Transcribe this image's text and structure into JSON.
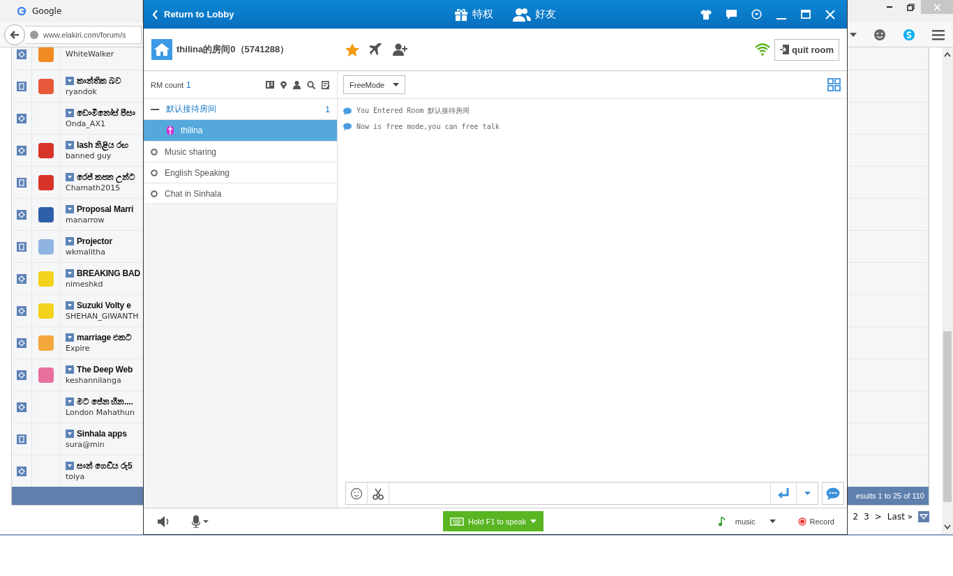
{
  "browser": {
    "tab_title": "Google",
    "url": "www.elakiri.com/forum/s"
  },
  "forum": {
    "threads": [
      {
        "kind": "diamond",
        "author": "WhiteWalker",
        "color": "#f08a24"
      },
      {
        "kind": "page",
        "title": "කාන්තික බව",
        "author": "ryandok",
        "color": "#e8583a"
      },
      {
        "kind": "diamond",
        "title": "ඩොමිනෝස් පීසා",
        "author": "Onda_AX1"
      },
      {
        "kind": "diamond",
        "title": "lash නිළිය රඟ",
        "author": "banned guy",
        "color": "#d9342b"
      },
      {
        "kind": "page",
        "title": "රෙජ් කපන උන්ට",
        "author": "Chamath2015",
        "color": "#d9342b"
      },
      {
        "kind": "diamond",
        "title": "Proposal Marri",
        "author": "manarrow",
        "color": "#2d5fa8"
      },
      {
        "kind": "page",
        "title": "Projector",
        "author": "wkmalitha",
        "color": "#8fb4e0"
      },
      {
        "kind": "diamond",
        "title": "BREAKING BAD",
        "author": "nimeshkd",
        "color": "#f3d21b"
      },
      {
        "kind": "diamond",
        "title": "Suzuki Volty e",
        "author": "SHEHAN_GIWANTH",
        "color": "#f3d21b"
      },
      {
        "kind": "diamond",
        "title": "marriage එකට",
        "author": "Expire",
        "color": "#f2a73a"
      },
      {
        "kind": "diamond",
        "title": "The Deep Web",
        "author": "keshannilanga",
        "color": "#e86f9e"
      },
      {
        "kind": "diamond",
        "title": "මට ජේන හීන....",
        "author": "London Mahathun"
      },
      {
        "kind": "page",
        "title": "Sinhala apps",
        "author": "sura@min"
      },
      {
        "kind": "diamond",
        "title": "සාන් ගෙඩිය රු5",
        "author": "toiya"
      }
    ],
    "results": "esults 1 to 25 of 110",
    "pages": [
      "2",
      "3",
      ">",
      "Last »"
    ]
  },
  "chat": {
    "back": "Return to Lobby",
    "nav": [
      {
        "label": "特权",
        "kind": "gift"
      },
      {
        "label": "好友",
        "kind": "friends"
      }
    ],
    "room_title": "thilina的房间0（5741288）",
    "quit": "quit room",
    "count_label": "RM count",
    "count": "1",
    "rooms": [
      {
        "name": "默认接待房间",
        "count": "1",
        "expanded": true,
        "children": [
          {
            "name": "thilina",
            "selected": true
          }
        ]
      },
      {
        "name": "Music sharing",
        "expanded": false
      },
      {
        "name": "English Speaking",
        "expanded": false
      },
      {
        "name": "Chat in Sinhala",
        "expanded": false
      }
    ],
    "mode": "FreeMode",
    "messages": [
      "You Entered Room 默认接待房间",
      "Now is free mode,you can free talk"
    ],
    "speak": "Hold F1 to speak",
    "music": "music",
    "record": "Record"
  }
}
